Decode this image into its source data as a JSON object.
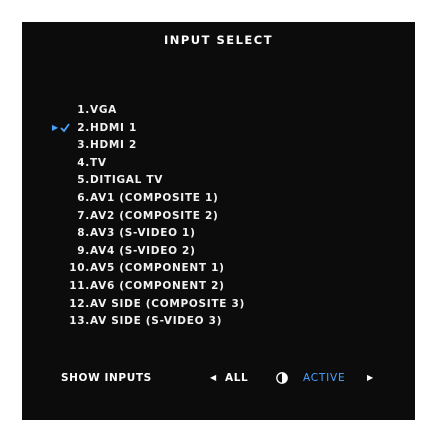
{
  "title": "INPUT SELECT",
  "inputs": [
    {
      "num": "1.",
      "label": "VGA"
    },
    {
      "num": "2.",
      "label": "HDMI 1",
      "selected": true
    },
    {
      "num": "3.",
      "label": "HDMI 2"
    },
    {
      "num": "4.",
      "label": "TV"
    },
    {
      "num": "5.",
      "label": "DITIGAL TV"
    },
    {
      "num": "6.",
      "label": " AV1 (COMPOSITE 1)"
    },
    {
      "num": "7.",
      "label": " AV2 (COMPOSITE 2)"
    },
    {
      "num": "8.",
      "label": " AV3 (S-VIDEO 1)"
    },
    {
      "num": "9.",
      "label": " AV4 (S-VIDEO 2)"
    },
    {
      "num": "10.",
      "label": " AV5 (COMPONENT 1)"
    },
    {
      "num": "11.",
      "label": " AV6 (COMPONENT 2)"
    },
    {
      "num": "12.",
      "label": " AV SIDE (COMPOSITE 3)"
    },
    {
      "num": "13.",
      "label": " AV SIDE (S-VIDEO 3)"
    }
  ],
  "footer": {
    "show_inputs": "SHOW INPUTS",
    "all": "ALL",
    "active": "ACTIVE"
  },
  "colors": {
    "background": "#0c0c0c",
    "text": "#f2f2f2",
    "accent": "#47a3ff"
  },
  "icons": {
    "selected_marker": "play-check-icon",
    "prev": "triangle-left-icon",
    "next": "triangle-right-icon",
    "toggle": "toggle-switch-icon"
  }
}
